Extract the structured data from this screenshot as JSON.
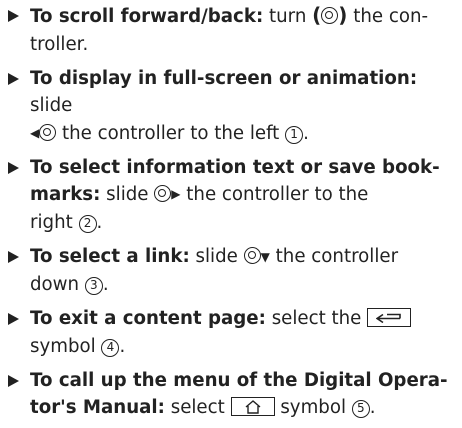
{
  "items": [
    {
      "bold": "To scroll forward/back:",
      "p1": " turn ",
      "p2": " the con-",
      "l2": "troller."
    },
    {
      "bold": "To display in full-screen or animation:",
      "p1": " slide",
      "p2": " the controller to the left ",
      "num": "1",
      "end": "."
    },
    {
      "bold1": "To select information text or save book-",
      "bold2": "marks:",
      "p1": " slide ",
      "p2": " the controller to the",
      "l3": "right ",
      "num": "2",
      "end": "."
    },
    {
      "bold": "To select a link:",
      "p1": " slide ",
      "p2": " the controller",
      "l2": "down ",
      "num": "3",
      "end": "."
    },
    {
      "bold": "To exit a content page:",
      "p1": " select the ",
      "l2": "symbol ",
      "num": "4",
      "end": "."
    },
    {
      "bold1": "To call up the menu of the Digital Opera-",
      "bold2": "tor's Manual:",
      "p1": " select ",
      "p2": " symbol ",
      "num": "5",
      "end": "."
    }
  ]
}
